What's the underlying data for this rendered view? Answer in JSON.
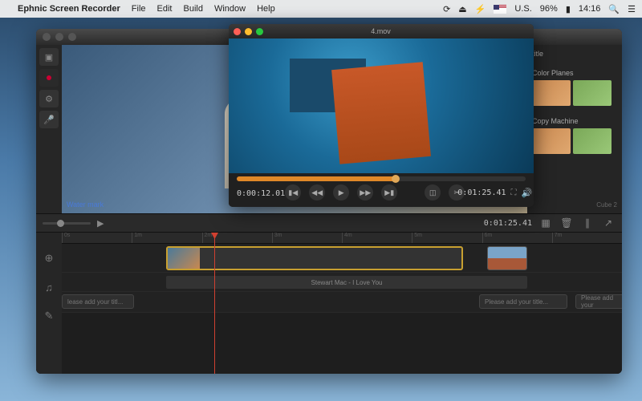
{
  "menubar": {
    "app_name": "Ephnic Screen Recorder",
    "items": [
      "File",
      "Edit",
      "Build",
      "Window",
      "Help"
    ],
    "battery": "96%",
    "clock": "14:16",
    "locale": "U.S."
  },
  "app": {
    "watermark": "Water mark",
    "right_panel": {
      "title_label": "title",
      "effect1": "Color Planes",
      "effect2": "Copy Machine",
      "badge": "Cube 2"
    },
    "midbar": {
      "timecode_right": "0:01:25.41"
    },
    "timeline": {
      "ruler_marks": [
        "0s",
        "1m",
        "2m",
        "3m",
        "4m",
        "5m",
        "6m",
        "7m"
      ],
      "audio_label": "Stewart Mac - I Love You",
      "title_placeholder1": "lease add your titl...",
      "title_placeholder2": "Please add your title...",
      "title_placeholder3": "Please add your"
    }
  },
  "preview_window": {
    "filename": "4.mov",
    "timecode_left": "0:00:12.01",
    "timecode_right": "0:01:25.41"
  }
}
